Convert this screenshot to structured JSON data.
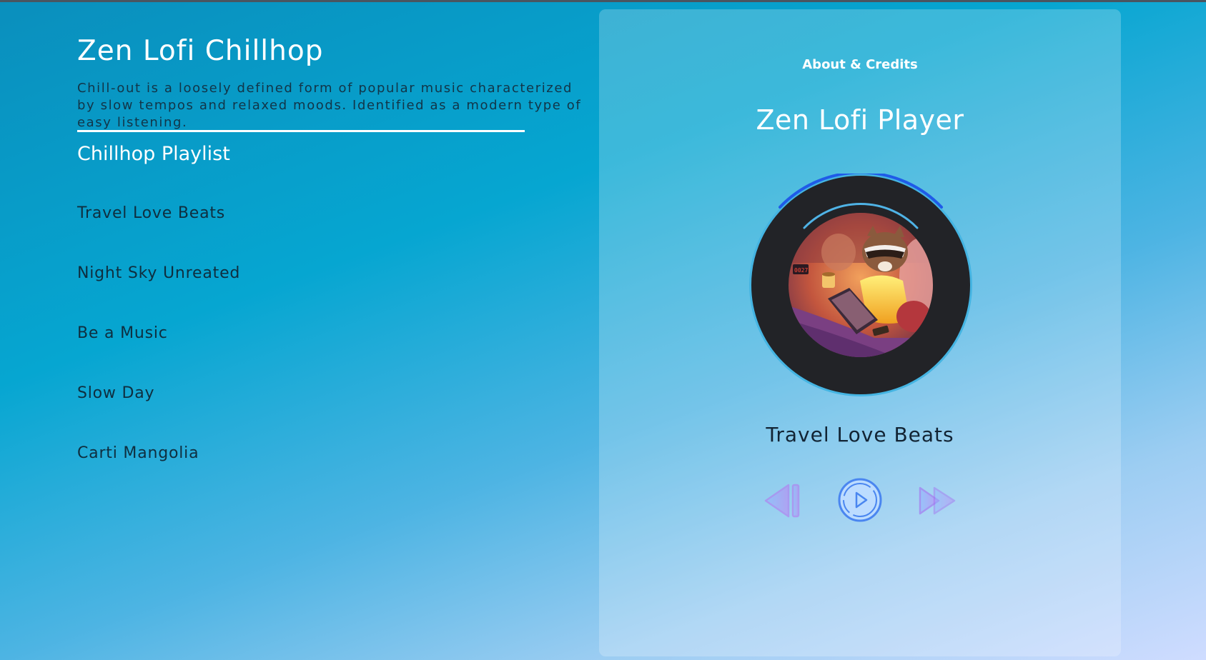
{
  "app": {
    "title": "Zen Lofi Chillhop",
    "description": "Chill-out is a loosely defined form of popular music characterized by slow tempos and relaxed moods. Identified as a modern type of easy listening."
  },
  "playlist": {
    "heading": "Chillhop Playlist",
    "tracks": [
      "Travel Love Beats",
      "Night Sky Unreated",
      "Be a Music",
      "Slow Day",
      "Carti Mangolia"
    ]
  },
  "player": {
    "about_label": "About & Credits",
    "title": "Zen Lofi Player",
    "now_playing": "Travel Love Beats",
    "artwork_icon": "raccoon-lofi-artwork",
    "controls": {
      "prev_icon": "skip-previous-icon",
      "play_icon": "play-icon",
      "next_icon": "fast-forward-icon"
    }
  },
  "colors": {
    "accent": "#1f5be8",
    "disc": "#222327",
    "disc_ring": "#44b4e2",
    "control_gradient_start": "#7fb2ff",
    "control_gradient_end": "#b45cf0"
  }
}
